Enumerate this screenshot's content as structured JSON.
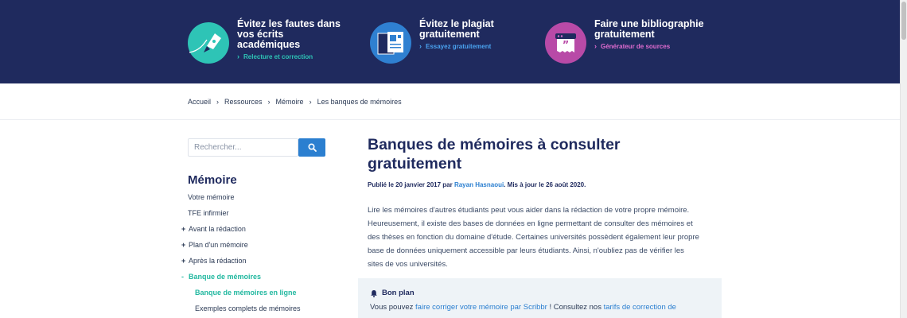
{
  "banner": {
    "promos": [
      {
        "title": "Évitez les fautes dans vos écrits académiques",
        "link": "Relecture et correction",
        "icon": "pen-nib-icon",
        "circle_color": "#2ec4b6",
        "link_color": "#2ec4b6"
      },
      {
        "title": "Évitez le plagiat gratuitement",
        "link": "Essayez gratuitement",
        "icon": "document-scan-icon",
        "circle_color": "#2f80d1",
        "link_color": "#4aa3f0"
      },
      {
        "title": "Faire une bibliographie gratuitement",
        "link": "Générateur de sources",
        "icon": "quote-generator-icon",
        "circle_color": "#b84aa7",
        "link_color": "#e06cd0"
      }
    ]
  },
  "breadcrumb": [
    "Accueil",
    "Ressources",
    "Mémoire",
    "Les banques de mémoires"
  ],
  "search": {
    "placeholder": "Rechercher..."
  },
  "sidebar": {
    "title": "Mémoire",
    "items": [
      {
        "prefix": "",
        "label": "Votre mémoire"
      },
      {
        "prefix": "",
        "label": "TFE infirmier"
      },
      {
        "prefix": "+",
        "label": "Avant la rédaction"
      },
      {
        "prefix": "+",
        "label": "Plan d'un mémoire"
      },
      {
        "prefix": "+",
        "label": "Après la rédaction"
      },
      {
        "prefix": "-",
        "label": "Banque de mémoires"
      },
      {
        "prefix": "",
        "label": "Banque de mémoires en ligne"
      },
      {
        "prefix": "",
        "label": "Exemples complets de mémoires"
      }
    ]
  },
  "article": {
    "title": "Banques de mémoires à consulter gratuitement",
    "meta": {
      "published": "Publié le 20 janvier 2017 par ",
      "author": "Rayan Hasnaoui",
      "updated": ". Mis à jour le 26 août 2020."
    },
    "intro": "Lire les mémoires d'autres étudiants peut vous aider dans la rédaction de votre propre mémoire. Heureusement, il existe des bases de données en ligne permettant de consulter des mémoires et des thèses en fonction du domaine d'étude. Certaines universités possèdent également leur propre base de données uniquement accessible par leurs étudiants. Ainsi, n'oubliez pas de vérifier les sites de vos universités.",
    "tip": {
      "title": "Bon plan",
      "text_before": "Vous pouvez ",
      "link1": "faire corriger votre mémoire par Scribbr",
      "text_middle": " ! Consultez nos ",
      "link2": "tarifs de correction de"
    }
  },
  "colors": {
    "navy": "#1f2a5e",
    "accent_blue": "#2b7fd0",
    "teal_active": "#22b8a0"
  }
}
